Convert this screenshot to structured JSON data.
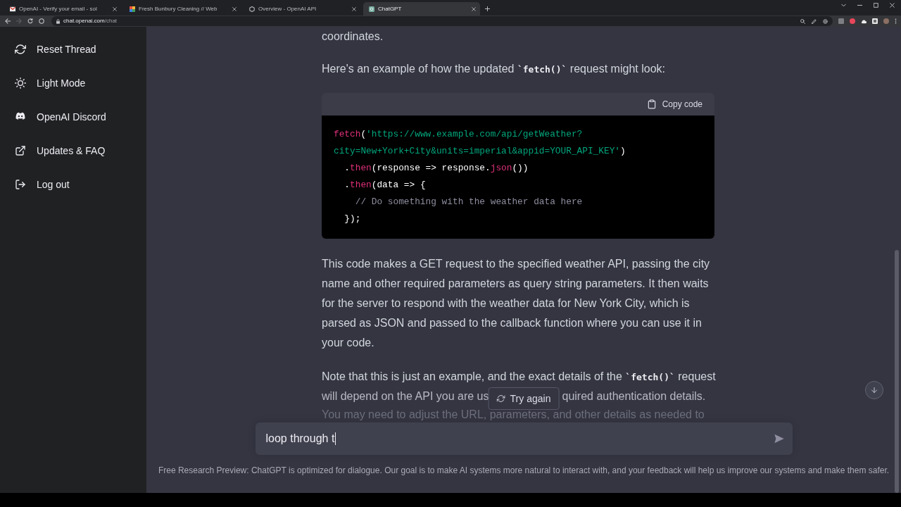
{
  "browser": {
    "tabs": [
      {
        "title": "OpenAI - Verify your email - sol",
        "selected": false
      },
      {
        "title": "Fresh Bunbury Cleaning // Web",
        "selected": false
      },
      {
        "title": "Overview - OpenAI API",
        "selected": false
      },
      {
        "title": "ChatGPT",
        "selected": true
      }
    ],
    "nav_buttons": [
      {
        "disabled": false
      },
      {
        "disabled": true
      },
      {
        "disabled": false
      }
    ],
    "address": {
      "host": "chat.openai.com",
      "path": "/chat"
    }
  },
  "sidebar": {
    "items": [
      {
        "label": "Reset Thread"
      },
      {
        "label": "Light Mode"
      },
      {
        "label": "OpenAI Discord"
      },
      {
        "label": "Updates & FAQ"
      },
      {
        "label": "Log out"
      }
    ]
  },
  "conversation": {
    "blocks": [
      {
        "kind": "paragraph",
        "lines": [
          [
            {
              "text": "coordinates."
            }
          ]
        ]
      },
      {
        "kind": "paragraph",
        "lines": [
          [
            {
              "text": "Here's an example of how the updated "
            },
            {
              "kind": "code",
              "text": "`fetch()`"
            },
            {
              "text": " request might look:"
            }
          ]
        ]
      },
      {
        "kind": "code",
        "copy_label": "Copy code",
        "lines": [
          [
            {
              "kind": "function",
              "text": "fetch"
            },
            {
              "kind": "plain",
              "text": "("
            },
            {
              "kind": "string",
              "text": "'https://www.example.com/api/getWeather?"
            }
          ],
          [
            {
              "kind": "string",
              "text": "city=New+York+City&units=imperial&appid=YOUR_API_KEY'"
            },
            {
              "kind": "plain",
              "text": ")"
            }
          ],
          [
            {
              "kind": "plain",
              "text": "  ."
            },
            {
              "kind": "function",
              "text": "then"
            },
            {
              "kind": "plain",
              "text": "(response => response."
            },
            {
              "kind": "function",
              "text": "json"
            },
            {
              "kind": "plain",
              "text": "())"
            }
          ],
          [
            {
              "kind": "plain",
              "text": "  ."
            },
            {
              "kind": "function",
              "text": "then"
            },
            {
              "kind": "plain",
              "text": "(data => {"
            }
          ],
          [
            {
              "kind": "comment",
              "text": "    // Do something with the weather data here"
            }
          ],
          [
            {
              "kind": "plain",
              "text": "  });"
            }
          ]
        ]
      },
      {
        "kind": "paragraph",
        "lines": [
          [
            {
              "text": "This code makes a GET request to the specified weather API, passing the city"
            }
          ],
          [
            {
              "text": "name and other required parameters as query string parameters. It then waits"
            }
          ],
          [
            {
              "text": "for the server to respond with the weather data for New York City, which is"
            }
          ],
          [
            {
              "text": "parsed as JSON and passed to the callback function where you can use it in"
            }
          ],
          [
            {
              "text": "your code."
            }
          ]
        ]
      },
      {
        "kind": "paragraph",
        "lines": [
          [
            {
              "text": "Note that this is just an example, and the exact details of the "
            },
            {
              "kind": "code",
              "text": "`fetch()`"
            },
            {
              "text": " request"
            }
          ],
          [
            {
              "text": "will depend on the API you are us"
            },
            {
              "kind": "covered"
            },
            {
              "text": "quired authentication details."
            }
          ],
          [
            {
              "text": "You may need to adjust the URL, parameters, and other details as needed to"
            }
          ]
        ]
      }
    ]
  },
  "try_again": {
    "label": "Try again"
  },
  "composer": {
    "value": "loop through t"
  },
  "footer": {
    "text": "Free Research Preview: ChatGPT is optimized for dialogue. Our goal is to make AI systems more natural to interact with, and your feedback will help us improve our systems and make them safer."
  }
}
